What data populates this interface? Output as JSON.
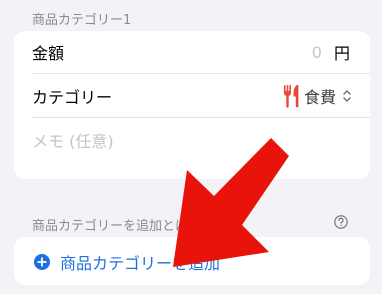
{
  "section": {
    "label": "商品カテゴリー1"
  },
  "form": {
    "amount": {
      "label": "金額",
      "value": "0",
      "unit": "円"
    },
    "category": {
      "label": "カテゴリー",
      "value": "食費",
      "icon": "fork-knife-icon",
      "icon_color": "#e8473a"
    },
    "memo": {
      "placeholder": "メモ (任意)"
    }
  },
  "help": {
    "label": "商品カテゴリーを追加とは？",
    "icon": "question-circle-icon"
  },
  "add_button": {
    "label": "商品カテゴリーを追加",
    "icon": "plus-circle-icon",
    "color": "#1e6fe0"
  },
  "annotation": {
    "arrow_color": "#e8140c"
  }
}
